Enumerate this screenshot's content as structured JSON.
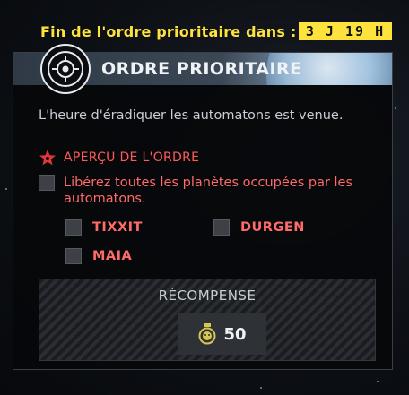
{
  "timer": {
    "label": "Fin de l'ordre prioritaire dans :",
    "value": "3 J 19 H"
  },
  "order": {
    "title": "ORDRE PRIORITAIRE",
    "briefing": "L'heure d'éradiquer les automatons est venue.",
    "overview_label": "APERÇU DE L'ORDRE",
    "objective": "Libérez toutes les planètes occupées par les automatons.",
    "planets": [
      "TIXXIT",
      "DURGEN",
      "MAIA"
    ]
  },
  "reward": {
    "label": "RÉCOMPENSE",
    "amount": "50",
    "icon": "medal-icon"
  },
  "colors": {
    "accent_yellow": "#ffe33d",
    "objective_red": "#ff5a5a",
    "panel_bg": "#06080a"
  }
}
